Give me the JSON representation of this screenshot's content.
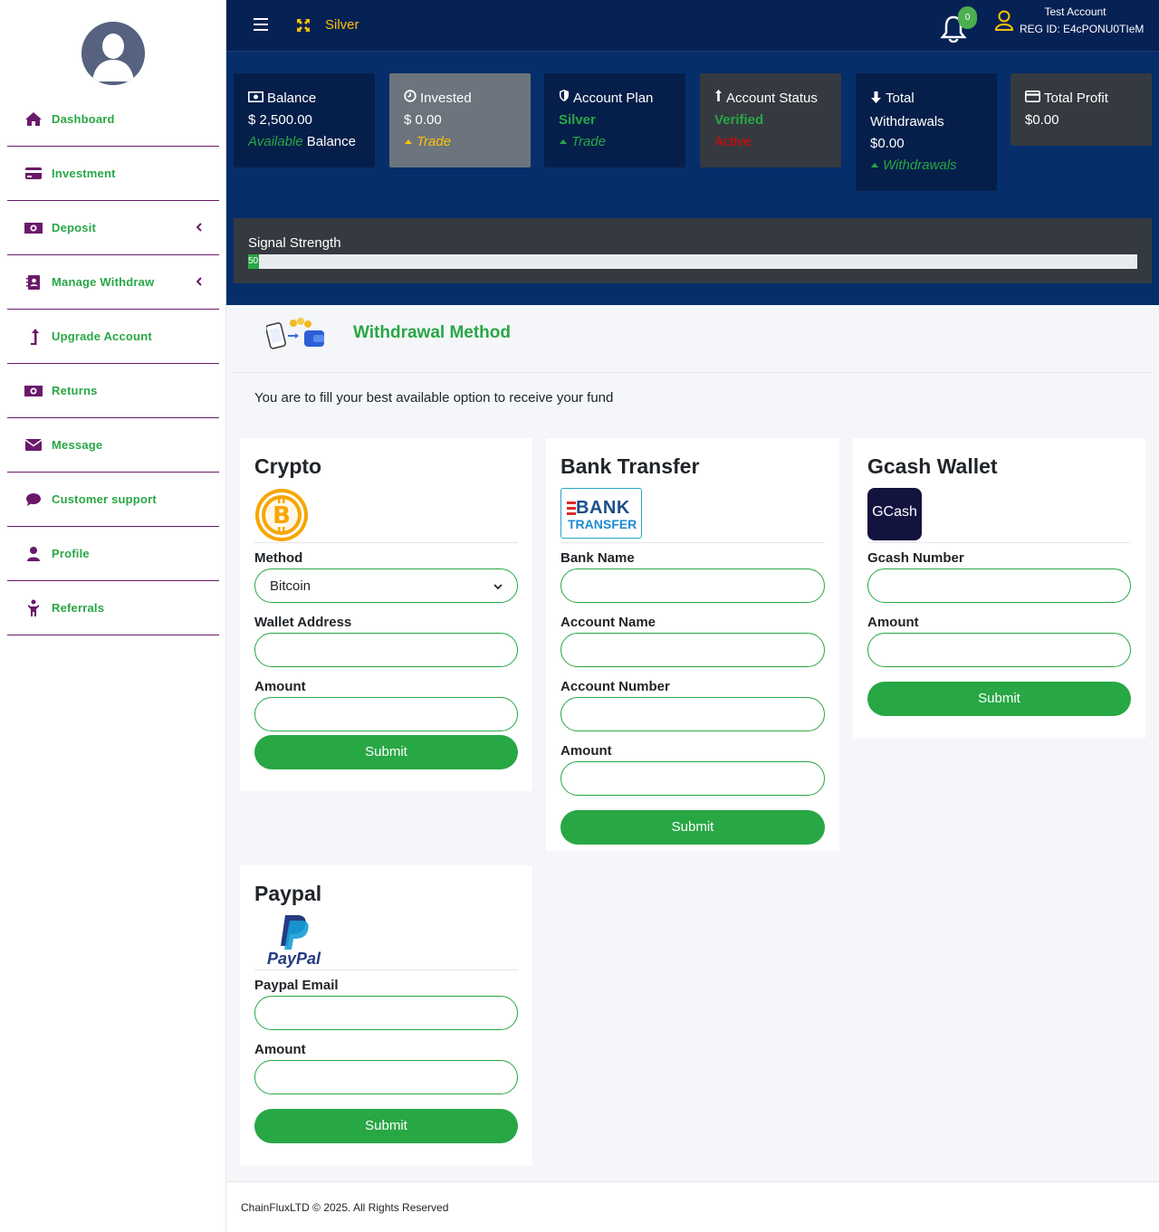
{
  "topbar": {
    "plan": "Silver",
    "notifications_count": "0",
    "user_name": "Test Account",
    "reg_id": "REG ID: E4cPONU0TIeM"
  },
  "sidebar": {
    "items": [
      {
        "label": "Dashboard",
        "icon": "home-icon"
      },
      {
        "label": "Investment",
        "icon": "credit-card-icon"
      },
      {
        "label": "Deposit",
        "icon": "money-icon"
      },
      {
        "label": "Manage Withdraw",
        "icon": "address-book-icon"
      },
      {
        "label": "Upgrade Account",
        "icon": "level-up-icon"
      },
      {
        "label": "Returns",
        "icon": "money-icon"
      },
      {
        "label": "Message",
        "icon": "envelope-icon"
      },
      {
        "label": "Customer support",
        "icon": "comment-icon"
      },
      {
        "label": "Profile",
        "icon": "user-icon"
      },
      {
        "label": "Referrals",
        "icon": "child-icon"
      }
    ]
  },
  "stats": {
    "balance": {
      "title": "Balance",
      "value": "$ 2,500.00",
      "sub_green": "Available",
      "sub_white": "Balance"
    },
    "invested": {
      "title": "Invested",
      "value": "$ 0.00",
      "sub": "Trade"
    },
    "account_plan": {
      "title": "Account Plan",
      "value": "Silver",
      "sub": "Trade"
    },
    "account_status": {
      "title": "Account Status",
      "value": "Verified",
      "sub": "Active"
    },
    "total_withdrawals": {
      "title": "Total Withdrawals",
      "value": "$0.00",
      "sub": "Withdrawals"
    },
    "total_profit": {
      "title": "Total Profit",
      "value": "$0.00"
    }
  },
  "signal": {
    "label": "Signal Strength",
    "value_text": "50",
    "fraction": 0.012
  },
  "main": {
    "title": "Withdrawal Method",
    "intro": "You are to fill your best available option to receive your fund"
  },
  "cards": {
    "crypto": {
      "title": "Crypto",
      "method_label": "Method",
      "method_value": "Bitcoin",
      "wallet_label": "Wallet Address",
      "amount_label": "Amount",
      "submit": "Submit"
    },
    "bank": {
      "title": "Bank Transfer",
      "logo_line1": "BANK",
      "logo_line2": "TRANSFER",
      "bank_name_label": "Bank Name",
      "account_name_label": "Account Name",
      "account_number_label": "Account Number",
      "amount_label": "Amount",
      "submit": "Submit"
    },
    "gcash": {
      "title": "Gcash Wallet",
      "logo_text": "GCash",
      "number_label": "Gcash Number",
      "amount_label": "Amount",
      "submit": "Submit"
    },
    "paypal": {
      "title": "Paypal",
      "logo_text": "PayPal",
      "email_label": "Paypal Email",
      "amount_label": "Amount",
      "submit": "Submit"
    }
  },
  "footer": {
    "text": "ChainFluxLTD © 2025. All Rights Reserved"
  },
  "colors": {
    "green": "#28a745",
    "navy": "#062154",
    "purple": "#6b1a6b",
    "yellow": "#ffc107"
  }
}
